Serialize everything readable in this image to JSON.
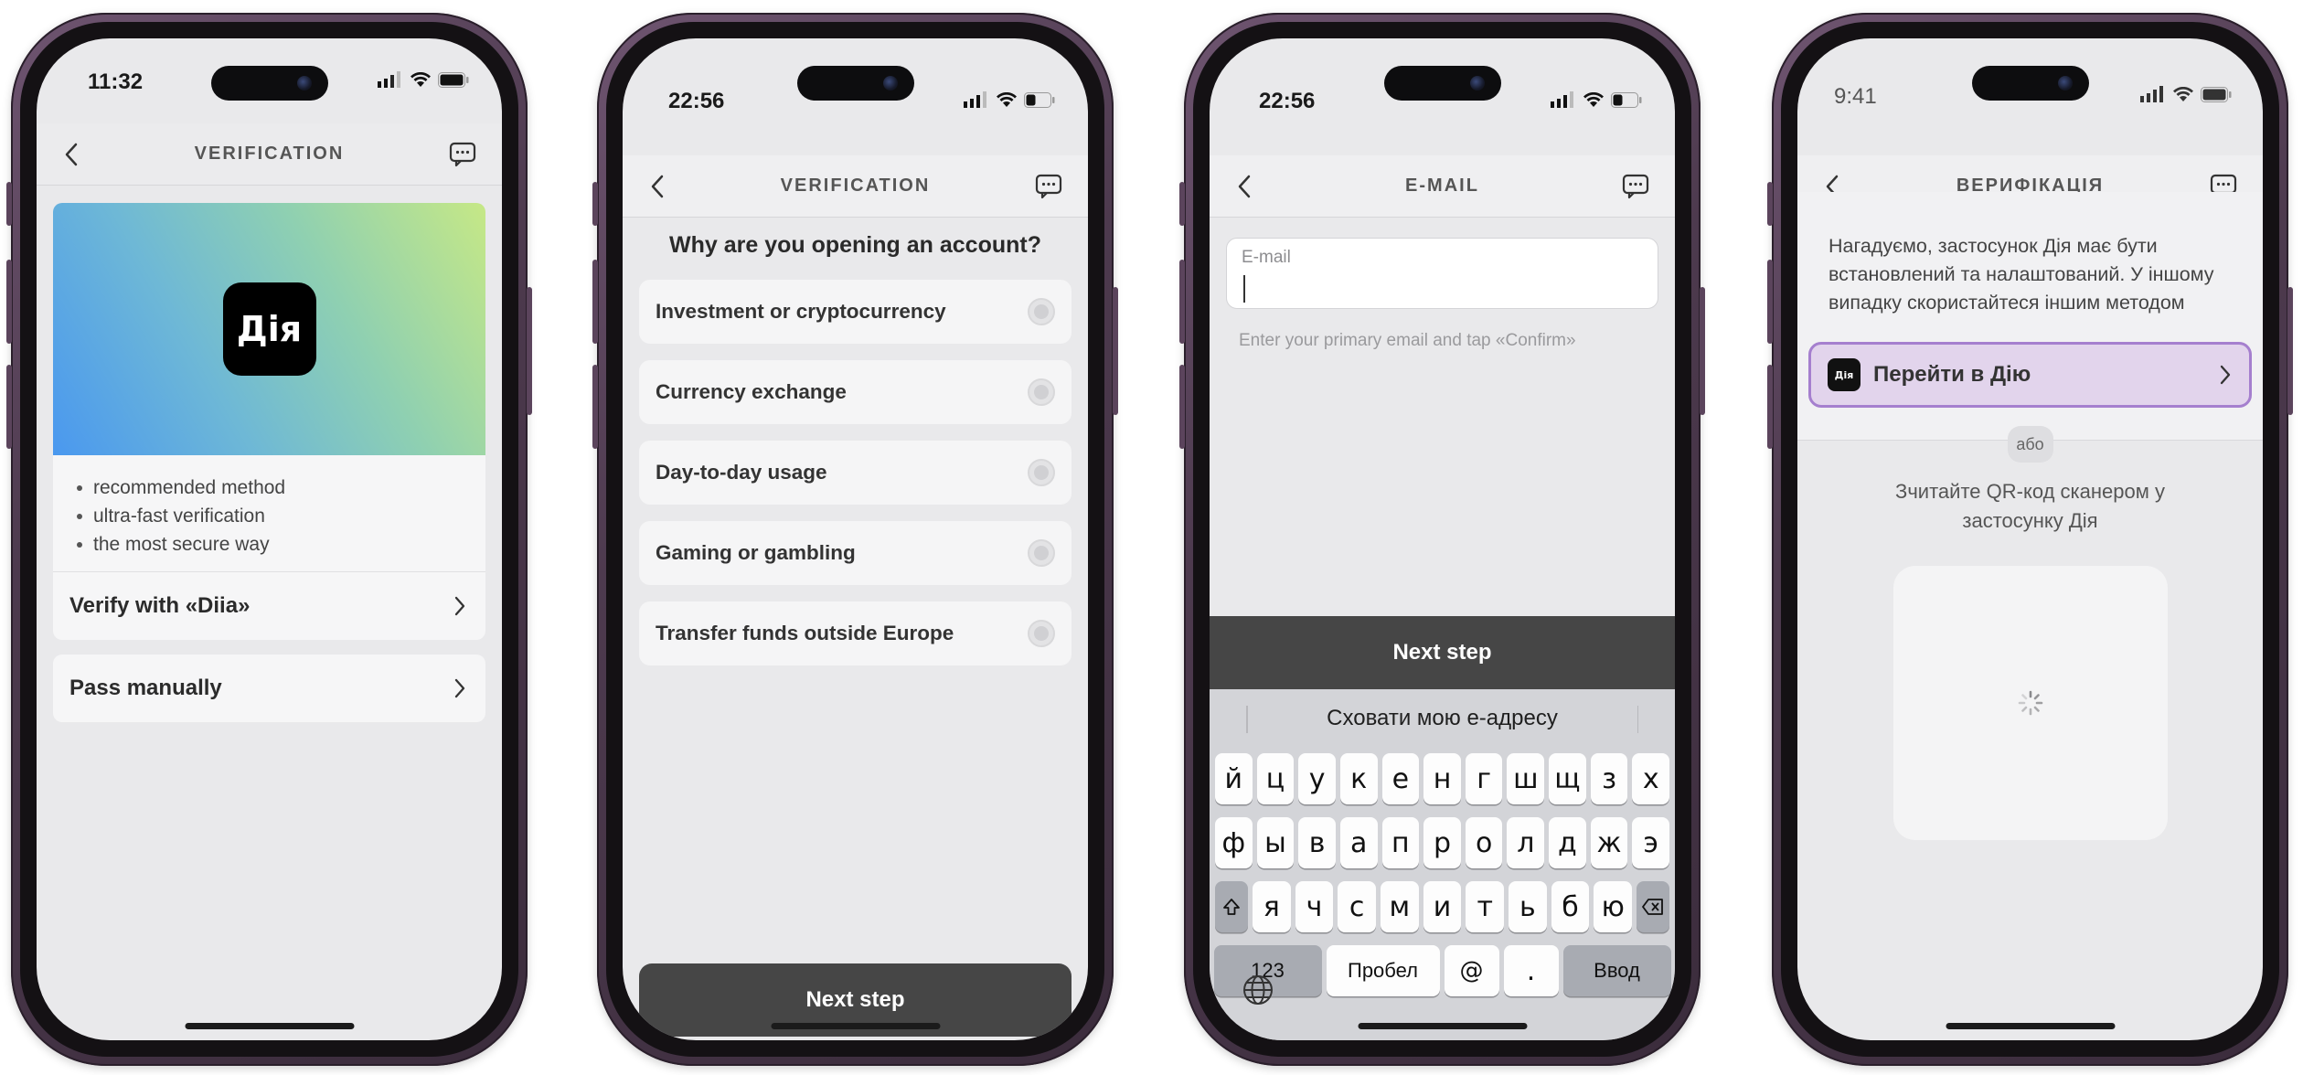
{
  "screens": [
    {
      "time": "11:32",
      "nav_title": "VERIFICATION",
      "logo_text": "Дія",
      "benefits": [
        "recommended method",
        "ultra-fast verification",
        "the most secure way"
      ],
      "options": [
        "Verify with «Diia»",
        "Pass manually"
      ]
    },
    {
      "time": "22:56",
      "nav_title": "VERIFICATION",
      "question": "Why are you opening an account?",
      "choices": [
        "Investment or cryptocurrency",
        "Currency exchange",
        "Day-to-day usage",
        "Gaming or gambling",
        "Transfer funds outside Europe"
      ],
      "next_label": "Next step"
    },
    {
      "time": "22:56",
      "nav_title": "E-MAIL",
      "email_placeholder": "E-mail",
      "email_value": "",
      "hint": "Enter your primary email and tap «Confirm»",
      "next_label": "Next step",
      "keyboard": {
        "suggestion": "Сховати мою е-адресу",
        "row1": [
          "й",
          "ц",
          "у",
          "к",
          "е",
          "н",
          "г",
          "ш",
          "щ",
          "з",
          "х"
        ],
        "row2": [
          "ф",
          "ы",
          "в",
          "а",
          "п",
          "р",
          "о",
          "л",
          "д",
          "ж",
          "э"
        ],
        "row3": [
          "я",
          "ч",
          "с",
          "м",
          "и",
          "т",
          "ь",
          "б",
          "ю"
        ],
        "numbers_key": "123",
        "space_key": "Пробел",
        "at_key": "@",
        "dot_key": ".",
        "return_key": "Ввод"
      }
    },
    {
      "time": "9:41",
      "nav_title": "ВЕРИФІКАЦІЯ",
      "reminder": "Нагадуємо, застосунок Дія має бути встановлений та налаштований. У іншому випадку скористайтеся іншим методом",
      "diia_button": "Перейти в Дію",
      "mini_logo": "Дія",
      "or_label": "або",
      "qr_instruction": "Зчитайте QR-код сканером у застосунку Дія"
    }
  ],
  "colors": {
    "dark_button": "#464646",
    "diia_link_bg": "#e2d4ec",
    "diia_link_border": "#a57fce",
    "screen_bg": "#e9e9eb"
  }
}
